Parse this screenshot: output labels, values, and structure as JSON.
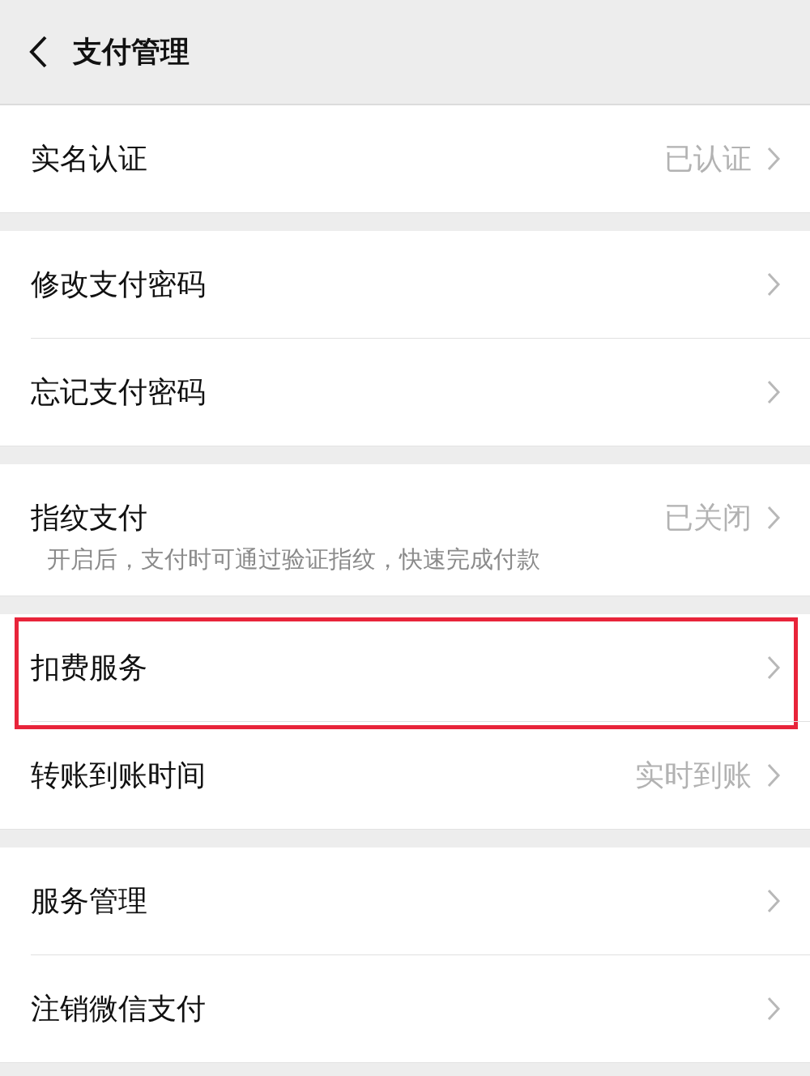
{
  "header": {
    "title": "支付管理"
  },
  "groups": [
    {
      "items": [
        {
          "label": "实名认证",
          "value": "已认证",
          "highlighted": false
        }
      ]
    },
    {
      "items": [
        {
          "label": "修改支付密码",
          "highlighted": false
        },
        {
          "label": "忘记支付密码",
          "highlighted": false
        }
      ]
    },
    {
      "items": [
        {
          "label": "指纹支付",
          "value": "已关闭",
          "note": "开启后，支付时可通过验证指纹，快速完成付款",
          "highlighted": false
        }
      ]
    },
    {
      "items": [
        {
          "label": "扣费服务",
          "highlighted": true
        },
        {
          "label": "转账到账时间",
          "value": "实时到账",
          "highlighted": false
        }
      ]
    },
    {
      "items": [
        {
          "label": "服务管理",
          "highlighted": false
        },
        {
          "label": "注销微信支付",
          "highlighted": false
        }
      ]
    }
  ]
}
